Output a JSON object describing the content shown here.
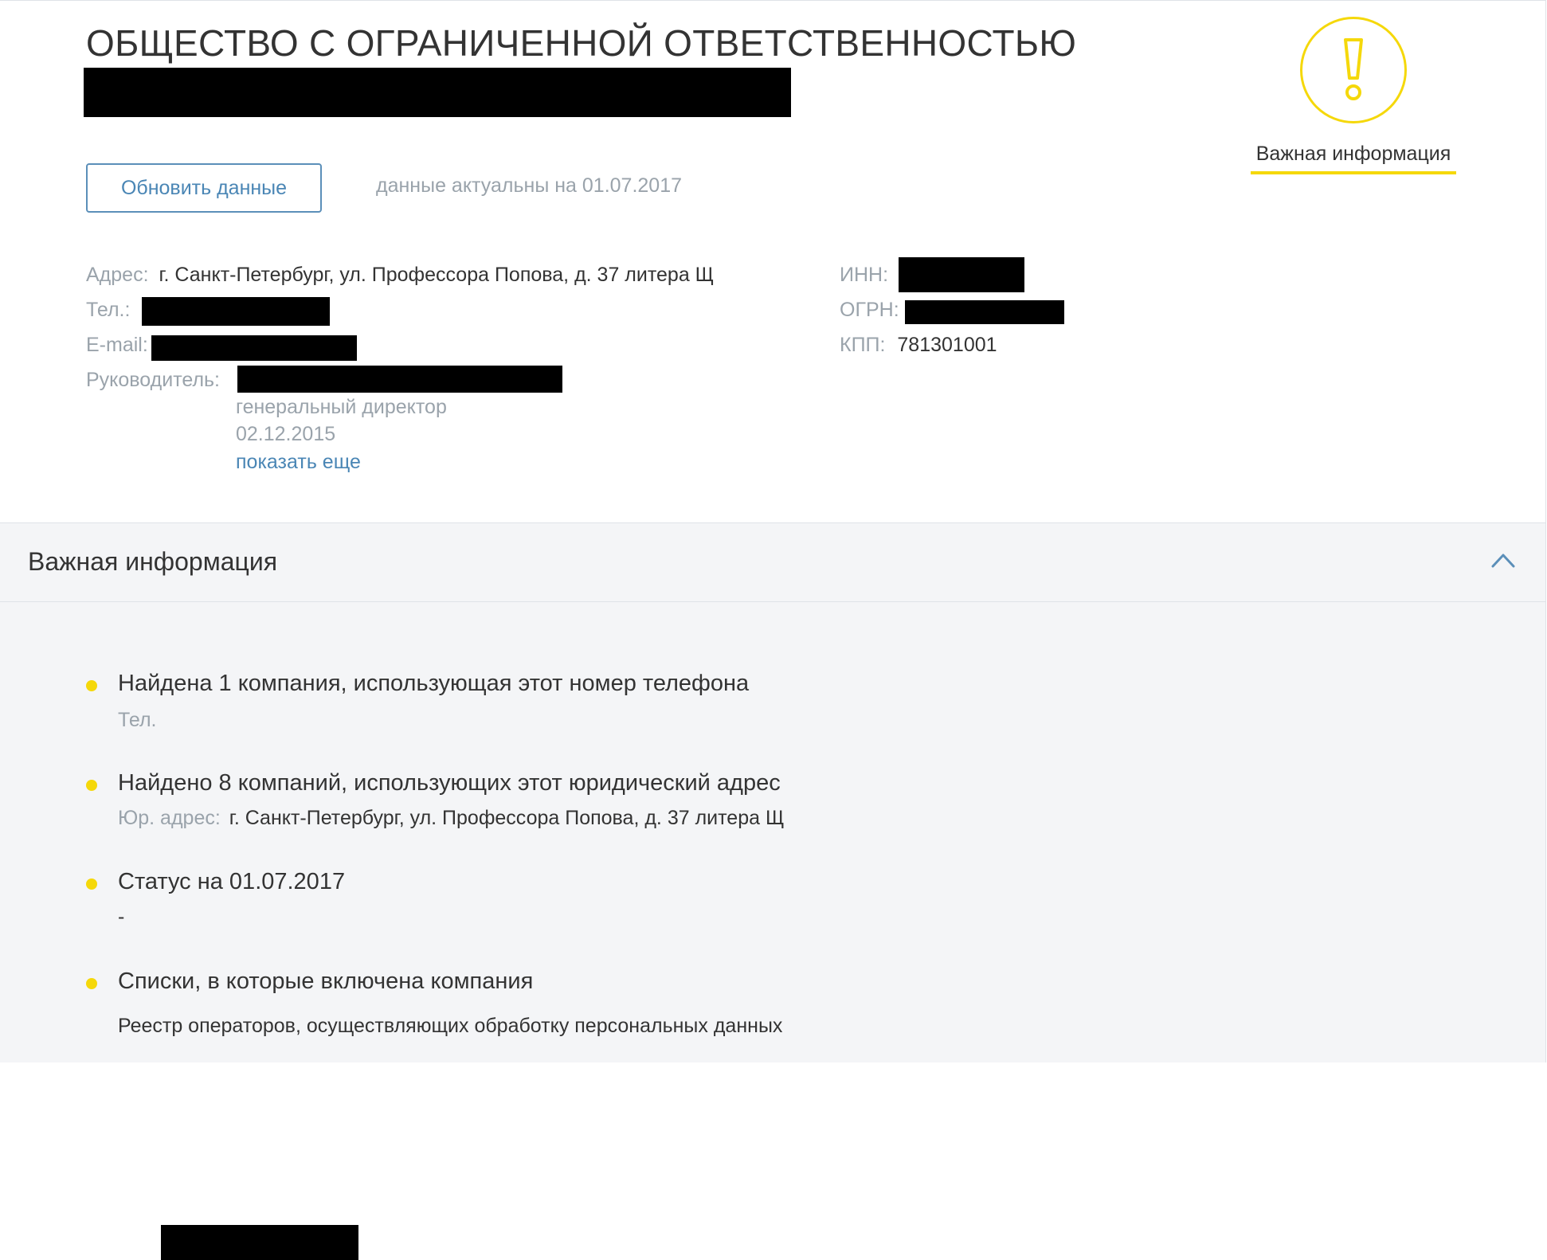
{
  "company": {
    "title": "ОБЩЕСТВО С ОГРАНИЧЕННОЙ ОТВЕТСТВЕННОСТЬЮ"
  },
  "actions": {
    "refresh_label": "Обновить данные",
    "actual_text": "данные актуальны на 01.07.2017"
  },
  "alert": {
    "label": "Важная информация",
    "icon": "exclamation-circle-icon",
    "color": "#f5d80a"
  },
  "details": {
    "address_label": "Адрес:",
    "address_value": "г. Санкт-Петербург, ул. Профессора Попова, д. 37 литера Щ",
    "phone_label": "Тел.:",
    "email_label": "E-mail:",
    "manager_label": "Руководитель:",
    "manager_position": "генеральный директор",
    "manager_date": "02.12.2015",
    "show_more": "показать еще",
    "inn_label": "ИНН:",
    "ogrn_label": "ОГРН:",
    "kpp_label": "КПП:",
    "kpp_value": "781301001"
  },
  "important": {
    "title": "Важная информация",
    "chevron_icon": "chevron-up-icon",
    "items": [
      {
        "title": "Найдена 1 компания, использующая этот номер телефона",
        "sub_label": "Тел."
      },
      {
        "title": "Найдено 8 компаний, использующих этот юридический адрес",
        "sub_label": "Юр. адрес:",
        "sub_value": "г. Санкт-Петербург, ул. Профессора Попова, д. 37 литера Щ"
      },
      {
        "title": "Статус на 01.07.2017",
        "sub_value": "-"
      },
      {
        "title": "Списки, в которые включена компания",
        "sub_value": "Реестр операторов, осуществляющих обработку персональных данных"
      }
    ]
  },
  "colors": {
    "accent_yellow": "#f5d80a",
    "link_blue": "#4a86b5",
    "label_gray": "#9aa3ab",
    "panel_bg": "#f4f5f7"
  }
}
